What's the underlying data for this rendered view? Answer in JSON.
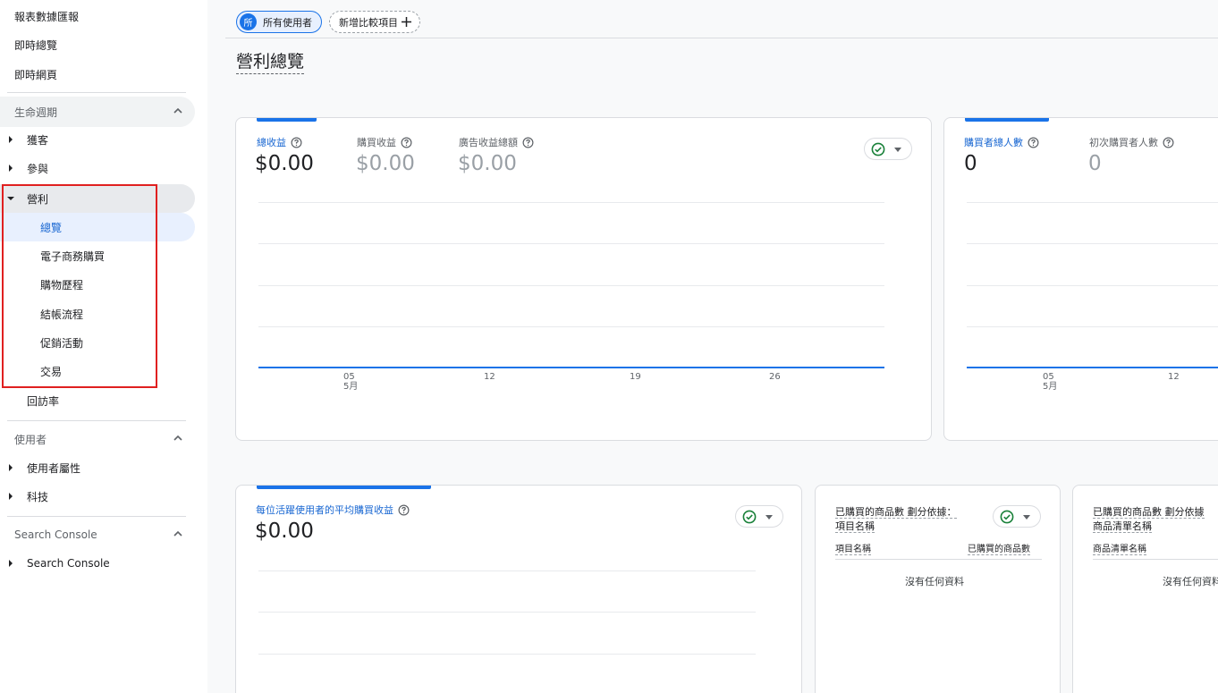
{
  "sidebar": {
    "top_items": [
      "報表數據匯報",
      "即時總覽",
      "即時網頁"
    ],
    "lifecycle": {
      "header": "生命週期",
      "items": {
        "acquisition": "獲客",
        "engagement": "參與",
        "monetization": "營利",
        "retention": "回訪率"
      },
      "monetization_sub": [
        "總覽",
        "電子商務購買",
        "購物歷程",
        "結帳流程",
        "促銷活動",
        "交易"
      ]
    },
    "user": {
      "header": "使用者",
      "items": [
        "使用者屬性",
        "科技"
      ]
    },
    "search_console": {
      "header": "Search Console",
      "items": [
        "Search Console"
      ]
    }
  },
  "header": {
    "chip_all_badge": "所",
    "chip_all_label": "所有使用者",
    "chip_add_label": "新增比較項目",
    "page_title": "營利總覽"
  },
  "revenue_card": {
    "metrics": [
      {
        "label": "總收益",
        "value": "$0.00"
      },
      {
        "label": "購買收益",
        "value": "$0.00"
      },
      {
        "label": "廣告收益總額",
        "value": "$0.00"
      }
    ],
    "x_ticks": [
      {
        "day": "05",
        "month": "5月"
      },
      {
        "day": "12",
        "month": ""
      },
      {
        "day": "19",
        "month": ""
      },
      {
        "day": "26",
        "month": ""
      }
    ]
  },
  "buyers_card": {
    "metrics": [
      {
        "label": "購買者總人數",
        "value": "0"
      },
      {
        "label": "初次購買者人數",
        "value": "0"
      }
    ],
    "x_ticks": [
      {
        "day": "05",
        "month": "5月"
      },
      {
        "day": "12",
        "month": ""
      }
    ]
  },
  "arppu_card": {
    "label": "每位活躍使用者的平均購買收益",
    "value": "$0.00"
  },
  "items_card": {
    "title_line1": "已購買的商品數 劃分依據：",
    "title_line2": "項目名稱",
    "col_left": "項目名稱",
    "col_right": "已購買的商品數",
    "empty": "沒有任何資料"
  },
  "lists_card": {
    "title_line1": "已購買的商品數 劃分依據",
    "title_line2": "商品清單名稱",
    "col_left": "商品清單名稱",
    "empty": "沒有任何資料"
  },
  "colors": {
    "accent": "#1a73e8",
    "active_nav_bg": "#e8f0fe",
    "highlight_box": "#e02020",
    "check_green": "#188038"
  }
}
